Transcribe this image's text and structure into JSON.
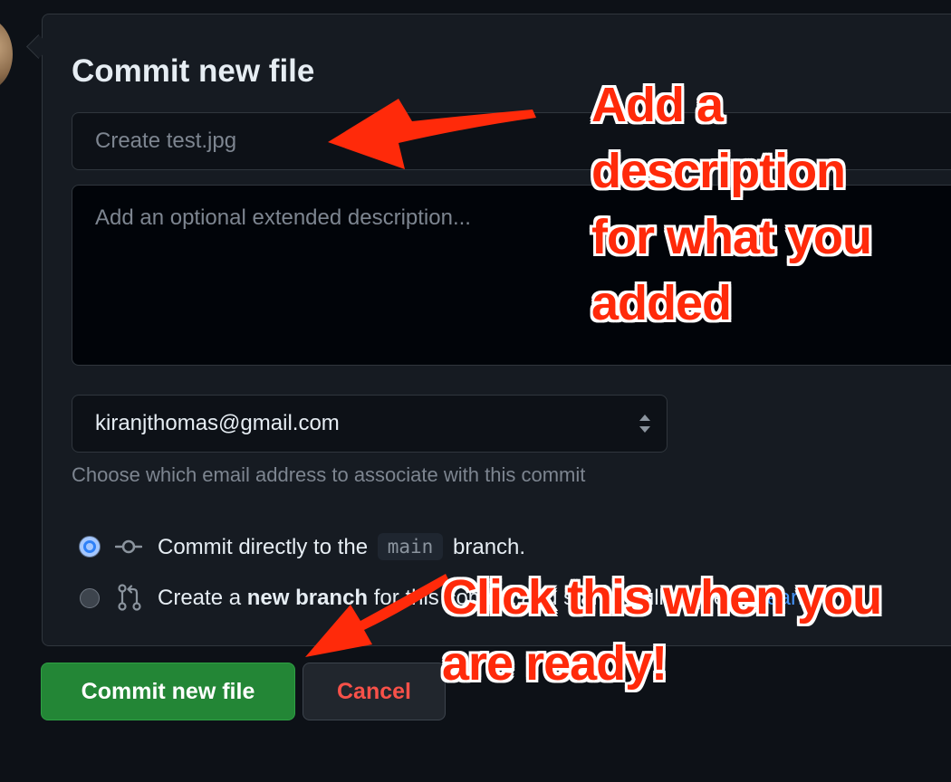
{
  "form": {
    "title": "Commit new file",
    "summary_placeholder": "Create test.jpg",
    "description_placeholder": "Add an optional extended description...",
    "email_value": "kiranjthomas@gmail.com",
    "email_help": "Choose which email address to associate with this commit"
  },
  "options": {
    "direct": {
      "prefix": "Commit directly to the",
      "branch": "main",
      "suffix": "branch.",
      "selected": true
    },
    "new_branch": {
      "prefix": "Create a",
      "bold": "new branch",
      "suffix": "for this commit and start a pull request.",
      "link": "Learn",
      "selected": false
    }
  },
  "buttons": {
    "commit": "Commit new file",
    "cancel": "Cancel"
  },
  "annotations": {
    "top": [
      "Add a",
      "description",
      "for what you",
      "added"
    ],
    "bottom": [
      "Click this when you",
      "are ready!"
    ],
    "color": "#ff2a0a"
  },
  "colors": {
    "background": "#0d1117",
    "panel": "#161b22",
    "commit_button": "#238636",
    "cancel_text": "#f85149",
    "link": "#4493f8"
  },
  "icons": {
    "direct": "git-commit-icon",
    "new_branch": "git-pull-request-icon"
  }
}
